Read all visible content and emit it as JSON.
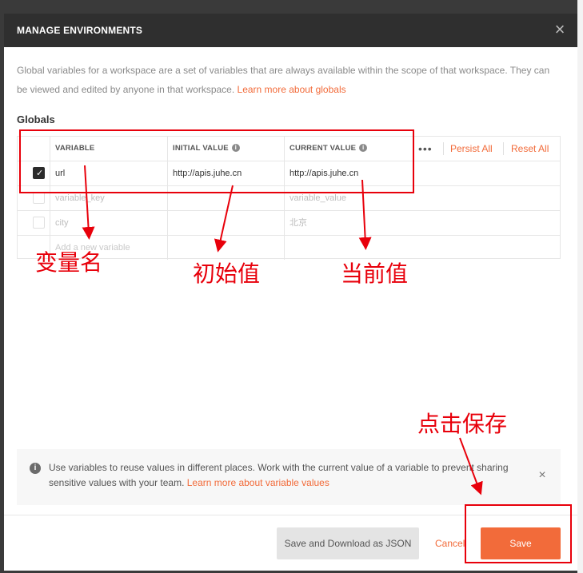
{
  "modal": {
    "title": "MANAGE ENVIRONMENTS",
    "close_icon": "×",
    "intro_text": "Global variables for a workspace are a set of variables that are always available within the scope of that workspace. They can be viewed and edited by anyone in that workspace.",
    "intro_link": "Learn more about globals",
    "section_label": "Globals"
  },
  "table": {
    "headers": {
      "variable": "VARIABLE",
      "initial_value": "INITIAL VALUE",
      "current_value": "CURRENT VALUE",
      "more_icon": "•••",
      "persist_all": "Persist All",
      "reset_all": "Reset All"
    },
    "rows": [
      {
        "checked": true,
        "variable": "url",
        "initial": "http://apis.juhe.cn",
        "current": "http://apis.juhe.cn"
      },
      {
        "checked": false,
        "variable": "variable_key",
        "initial": "",
        "current": "variable_value"
      },
      {
        "checked": false,
        "variable": "city",
        "initial": "",
        "current": "北京"
      }
    ],
    "new_variable_placeholder": "Add a new variable"
  },
  "annotations": {
    "variable_name": "变量名",
    "initial_value": "初始值",
    "current_value": "当前值",
    "click_save": "点击保存",
    "color": "#e8000b"
  },
  "tip": {
    "icon": "i",
    "text": "Use variables to reuse values in different places. Work with the current value of a variable to prevent sharing sensitive values with your team.",
    "link": "Learn more about variable values",
    "close_icon": "×"
  },
  "footer": {
    "save_download_json": "Save and Download as JSON",
    "cancel": "Cancel",
    "save": "Save"
  },
  "colors": {
    "accent": "#f26b3a",
    "header_bg": "#2f2f2f"
  }
}
